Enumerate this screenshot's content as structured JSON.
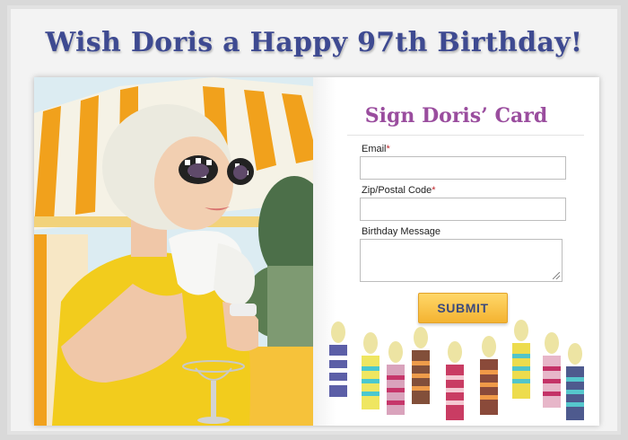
{
  "headline": "Wish Doris a Happy 97th Birthday!",
  "form": {
    "title": "Sign Doris’ Card",
    "email_label": "Email",
    "zip_label": "Zip/Postal Code",
    "message_label": "Birthday Message",
    "required_mark": "*",
    "email_value": "",
    "zip_value": "",
    "message_value": "",
    "submit_label": "SUBMIT"
  },
  "colors": {
    "headline": "#3e4a91",
    "form_title": "#9a4d9e",
    "submit_bg": "#f4b331",
    "submit_text": "#3b4a7d"
  }
}
